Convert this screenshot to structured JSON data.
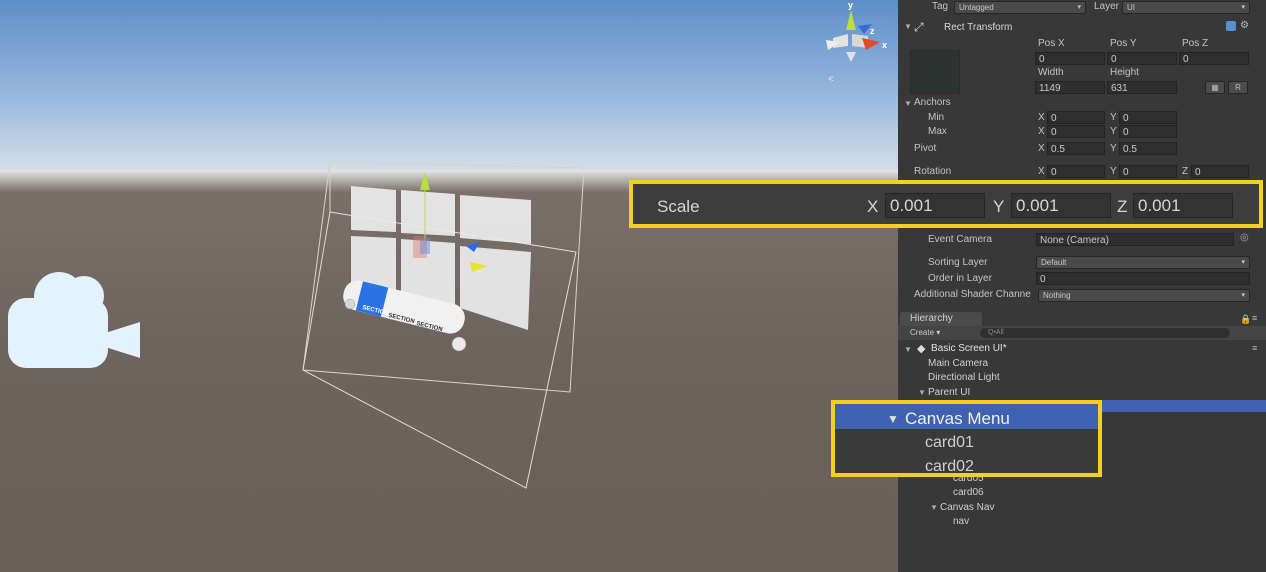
{
  "inspector": {
    "tag_label": "Tag",
    "tag_value": "Untagged",
    "layer_label": "Layer",
    "layer_value": "UI",
    "component_title": "Rect Transform",
    "pos_x_label": "Pos X",
    "pos_y_label": "Pos Y",
    "pos_z_label": "Pos Z",
    "pos_x": "0",
    "pos_y": "0",
    "pos_z": "0",
    "width_label": "Width",
    "height_label": "Height",
    "width": "1149",
    "height": "631",
    "r_button": "R",
    "anchors_label": "Anchors",
    "min_label": "Min",
    "max_label": "Max",
    "pivot_label": "Pivot",
    "rotation_label": "Rotation",
    "axis_x": "X",
    "axis_y": "Y",
    "axis_z": "Z",
    "anchor_min_x": "0",
    "anchor_min_y": "0",
    "anchor_max_x": "0",
    "anchor_max_y": "0",
    "pivot_x": "0.5",
    "pivot_y": "0.5",
    "rotation_x": "0",
    "rotation_y": "0",
    "rotation_z": "0",
    "scale_label": "Scale",
    "scale_x": "0.001",
    "scale_y": "0.001",
    "scale_z": "0.001",
    "event_camera_label": "Event Camera",
    "event_camera_value": "None (Camera)",
    "sorting_layer_label": "Sorting Layer",
    "sorting_layer_value": "Default",
    "order_in_layer_label": "Order in Layer",
    "order_in_layer_value": "0",
    "shader_channels_label": "Additional Shader Channe",
    "shader_channels_value": "Nothing"
  },
  "hierarchy": {
    "tab_label": "Hierarchy",
    "create_label": "Create",
    "search_placeholder": "Q•All",
    "scene_name": "Basic Screen UI*",
    "items": {
      "main_camera": "Main Camera",
      "directional_light": "Directional Light",
      "parent_ui": "Parent UI",
      "canvas_menu": "Canvas Menu",
      "card01": "card01",
      "card02": "card02",
      "card05": "card05",
      "card06": "card06",
      "canvas_nav": "Canvas Nav",
      "nav": "nav"
    }
  },
  "scene": {
    "section_tabs": [
      "SECTION",
      "SECTION",
      "SECTION"
    ],
    "gizmo_y": "y",
    "gizmo_x": "x",
    "gizmo_z": "z",
    "persp_label": "<"
  },
  "colors": {
    "highlight": "#f5cf1f",
    "selection": "#3e62b0",
    "section_active": "#2a72e6"
  }
}
